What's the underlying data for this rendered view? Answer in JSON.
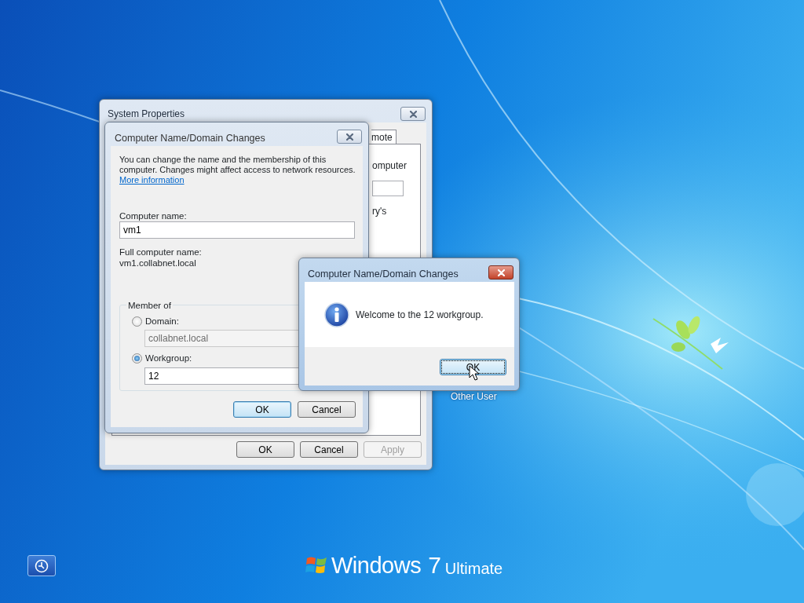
{
  "desktop": {
    "user_label": "Other User",
    "branding": {
      "product": "Windows",
      "version": "7",
      "edition": "Ultimate"
    }
  },
  "system_properties": {
    "title": "System Properties",
    "tab_fragment": "mote",
    "text_fragments": [
      "omputer",
      "ry's"
    ],
    "buttons": [
      {
        "label": "OK",
        "disabled": false
      },
      {
        "label": "Cancel",
        "disabled": false
      },
      {
        "label": "Apply",
        "disabled": true
      }
    ]
  },
  "name_dialog": {
    "title": "Computer Name/Domain Changes",
    "description": "You can change the name and the membership of this computer. Changes might affect access to network resources.",
    "link": "More information",
    "computer_name_label": "Computer name:",
    "computer_name": "vm1",
    "full_name_label": "Full computer name:",
    "full_name": "vm1.collabnet.local",
    "group_title": "Member of",
    "options": [
      {
        "label": "Domain:",
        "selected": false,
        "value": "collabnet.local"
      },
      {
        "label": "Workgroup:",
        "selected": true,
        "value": "12"
      }
    ],
    "buttons": [
      {
        "label": "OK",
        "default": true
      },
      {
        "label": "Cancel",
        "default": false
      }
    ]
  },
  "message_box": {
    "title": "Computer Name/Domain Changes",
    "message": "Welcome to the 12 workgroup.",
    "button": {
      "label": "OK",
      "focused": true
    }
  }
}
